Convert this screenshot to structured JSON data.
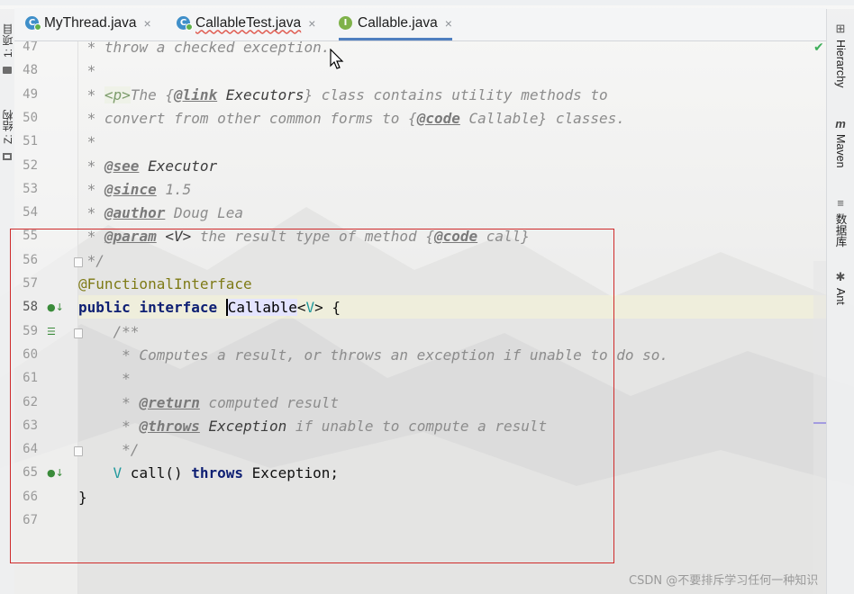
{
  "tabs": [
    {
      "label": "MyThread.java",
      "icon": "class-file-icon",
      "active": false,
      "close": "×"
    },
    {
      "label": "CallableTest.java",
      "icon": "class-file-icon",
      "active": false,
      "close": "×"
    },
    {
      "label": "Callable.java",
      "icon": "interface-file-icon",
      "active": true,
      "close": "×"
    }
  ],
  "tab_icon_letters": {
    "class": "C",
    "interface": "I"
  },
  "left_tools": {
    "project": "1: 项目",
    "structure": "Z: 结构"
  },
  "right_tools": {
    "hierarchy": "Hierarchy",
    "maven": "Maven",
    "database": "数据库",
    "ant": "Ant"
  },
  "editor": {
    "current_line": 58,
    "lines": [
      {
        "n": "47",
        "t": [
          [
            " * throw a checked exception.",
            "cm"
          ]
        ]
      },
      {
        "n": "48",
        "t": [
          [
            " *",
            "cm"
          ]
        ]
      },
      {
        "n": "49",
        "t": [
          [
            " * ",
            "cm"
          ],
          [
            "<p>",
            "tag"
          ],
          [
            "The {",
            "cm"
          ],
          [
            "@link",
            "jdtag"
          ],
          [
            " Executors",
            "ref"
          ],
          [
            "} class contains utility methods to",
            "cm"
          ]
        ]
      },
      {
        "n": "50",
        "t": [
          [
            " * convert from other common forms to {",
            "cm"
          ],
          [
            "@code",
            "jdtag"
          ],
          [
            " Callable} classes.",
            "cm"
          ]
        ]
      },
      {
        "n": "51",
        "t": [
          [
            " *",
            "cm"
          ]
        ]
      },
      {
        "n": "52",
        "t": [
          [
            " * ",
            "cm"
          ],
          [
            "@see",
            "jdtag"
          ],
          [
            " Executor",
            "ref"
          ]
        ]
      },
      {
        "n": "53",
        "t": [
          [
            " * ",
            "cm"
          ],
          [
            "@since",
            "jdtag"
          ],
          [
            " 1.5",
            "cm"
          ]
        ]
      },
      {
        "n": "54",
        "t": [
          [
            " * ",
            "cm"
          ],
          [
            "@author",
            "jdtag"
          ],
          [
            " Doug Lea",
            "cm"
          ]
        ]
      },
      {
        "n": "55",
        "t": [
          [
            " * ",
            "cm"
          ],
          [
            "@param",
            "jdtag"
          ],
          [
            " <V>",
            "ref"
          ],
          [
            " the result type of method {",
            "cm"
          ],
          [
            "@code",
            "jdtag"
          ],
          [
            " call}",
            "cm"
          ]
        ]
      },
      {
        "n": "56",
        "t": [
          [
            " */",
            "cm"
          ]
        ]
      },
      {
        "n": "57",
        "t": [
          [
            "@FunctionalInterface",
            "ann"
          ]
        ]
      },
      {
        "n": "58",
        "t": [
          [
            "public",
            "kw"
          ],
          [
            " ",
            "pl"
          ],
          [
            "interface",
            "kw"
          ],
          [
            " ",
            "pl"
          ],
          [
            "Callable",
            "hl"
          ],
          [
            "<",
            "pl"
          ],
          [
            "V",
            "tp"
          ],
          [
            "> {",
            "pl"
          ]
        ]
      },
      {
        "n": "59",
        "t": [
          [
            "    /**",
            "cm"
          ]
        ]
      },
      {
        "n": "60",
        "t": [
          [
            "     * Computes a result, or throws an exception if unable to do so.",
            "cm"
          ]
        ]
      },
      {
        "n": "61",
        "t": [
          [
            "     *",
            "cm"
          ]
        ]
      },
      {
        "n": "62",
        "t": [
          [
            "     * ",
            "cm"
          ],
          [
            "@return",
            "jdtag"
          ],
          [
            " computed result",
            "cm"
          ]
        ]
      },
      {
        "n": "63",
        "t": [
          [
            "     * ",
            "cm"
          ],
          [
            "@throws",
            "jdtag"
          ],
          [
            " Exception",
            "ref"
          ],
          [
            " if unable to compute a result",
            "cm"
          ]
        ]
      },
      {
        "n": "64",
        "t": [
          [
            "     */",
            "cm"
          ]
        ]
      },
      {
        "n": "65",
        "t": [
          [
            "    ",
            "pl"
          ],
          [
            "V",
            "tp"
          ],
          [
            " call() ",
            "pl"
          ],
          [
            "throws",
            "kw"
          ],
          [
            " Exception;",
            "pl"
          ]
        ]
      },
      {
        "n": "66",
        "t": [
          [
            "}",
            "pl"
          ]
        ]
      },
      {
        "n": "67",
        "t": []
      }
    ]
  },
  "inspection_status": "✔",
  "watermark": "CSDN @不要排斥学习任何一种知识",
  "colors": {
    "keyword": "#0e1f73",
    "comment": "#8c8c8c",
    "annotation": "#7e7a16",
    "type_param": "#20999d",
    "highlight_box": "#cf2a2a",
    "active_tab_underline": "#4f7fc0"
  }
}
